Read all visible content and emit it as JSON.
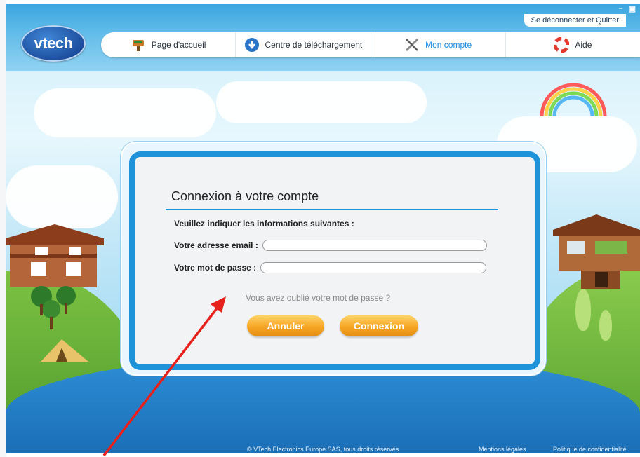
{
  "window": {
    "minimize": "–",
    "maximize": "▣"
  },
  "header": {
    "logout_label": "Se déconnecter et Quitter",
    "logo_text": "vtech",
    "nav": [
      {
        "label": "Page d'accueil",
        "icon": "house-sign-icon",
        "active": false
      },
      {
        "label": "Centre de téléchargement",
        "icon": "download-icon",
        "active": false
      },
      {
        "label": "Mon compte",
        "icon": "tools-icon",
        "active": true
      },
      {
        "label": "Aide",
        "icon": "lifebuoy-icon",
        "active": false
      }
    ]
  },
  "dialog": {
    "title": "Connexion à votre compte",
    "intro": "Veuillez indiquer les informations suivantes :",
    "email_label": "Votre adresse email :",
    "email_value": "",
    "password_label": "Votre mot de passe :",
    "password_value": "",
    "forgot_link": "Vous avez oublié votre mot de passe ?",
    "cancel_label": "Annuler",
    "connect_label": "Connexion"
  },
  "footer": {
    "copyright": "© VTech Electronics Europe SAS, tous droits réservés",
    "legal": "Mentions légales",
    "privacy": "Politique de confidentialité"
  },
  "colors": {
    "accent": "#1f93d9",
    "button": "#f6a623",
    "annotation_arrow": "#e8201c"
  }
}
